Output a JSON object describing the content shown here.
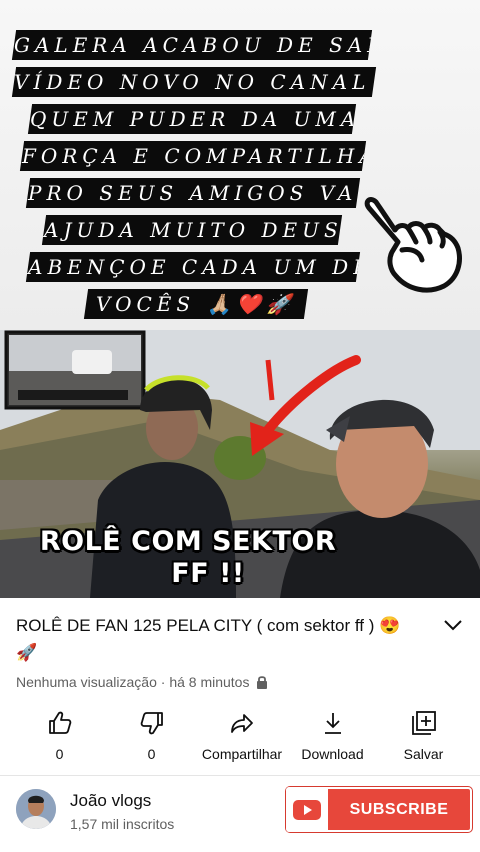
{
  "caption": {
    "lines": [
      "GALERA ACABOU DE SAI",
      "VÍDEO NOVO NO CANAL ,",
      "QUEM PUDER DA UMA",
      "FORÇA E COMPARTILHA",
      "PRO SEUS AMIGOS VAI",
      "AJUDA MUITO DEUS",
      "ABENÇOE CADA UM DE",
      "VOCÊS 🙏🏼❤️🚀"
    ]
  },
  "thumbnail": {
    "overlay_text_line1": "ROLÊ COM SEKTOR",
    "overlay_text_line2": "FF !!"
  },
  "video": {
    "title": "ROLÊ DE FAN 125 PELA CITY  ( com sektor ff ) 😍🚀",
    "views": "Nenhuma visualização",
    "separator": " · ",
    "uploaded": "há 8 minutos"
  },
  "actions": {
    "like_count": "0",
    "dislike_count": "0",
    "share_label": "Compartilhar",
    "download_label": "Download",
    "save_label": "Salvar"
  },
  "channel": {
    "name": "João vlogs",
    "subscribers": "1,57 mil inscritos"
  },
  "subscribe": {
    "label": "SUBSCRIBE"
  },
  "colors": {
    "subscribe_red": "#e7473b",
    "meta_gray": "#606060",
    "arrow_red": "#e2231a"
  }
}
